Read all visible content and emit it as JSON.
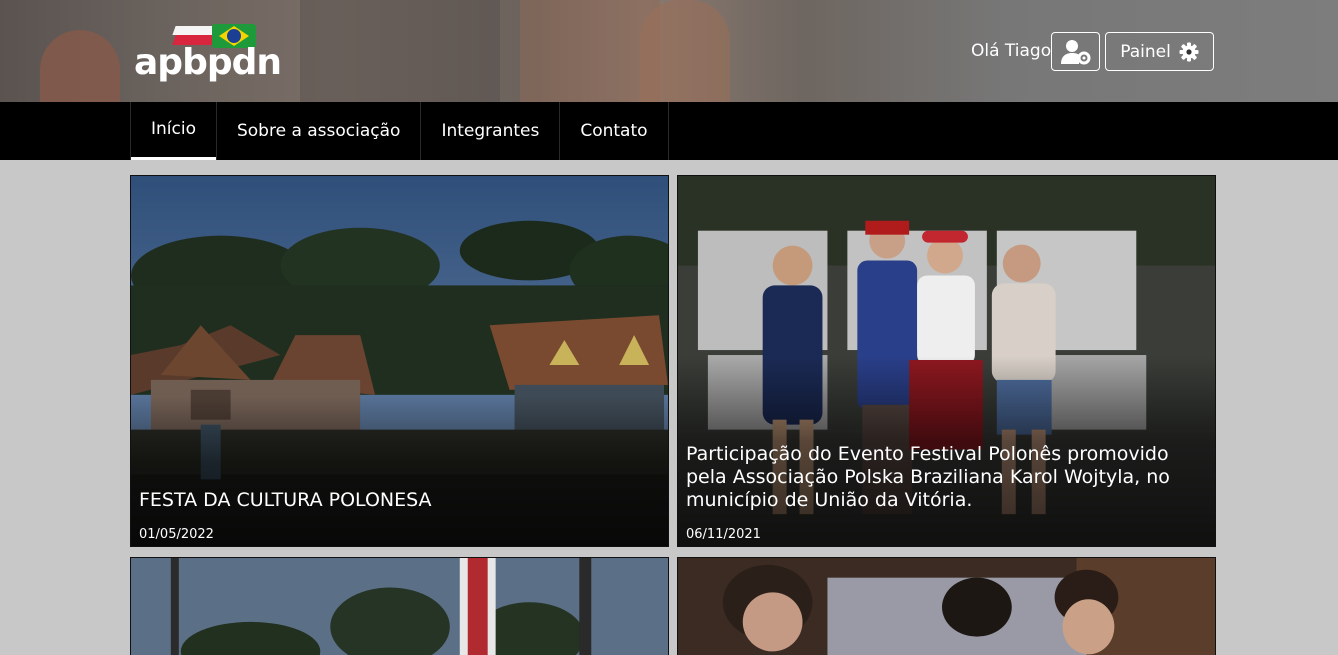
{
  "header": {
    "logo_text": "apbpdn",
    "greeting": "Olá Tiago",
    "user_button_icon": "user-cog-icon",
    "panel_label": "Painel",
    "panel_icon": "gear-icon"
  },
  "nav": {
    "items": [
      {
        "label": "Início",
        "active": true
      },
      {
        "label": "Sobre a associação",
        "active": false
      },
      {
        "label": "Integrantes",
        "active": false
      },
      {
        "label": "Contato",
        "active": false
      }
    ]
  },
  "posts": [
    {
      "title": "FESTA DA CULTURA POLONESA",
      "date": "01/05/2022"
    },
    {
      "title": "Participação do Evento Festival Polonês promovido pela Associação Polska Braziliana Karol Wojtyla, no município de União da Vitória.",
      "date": "06/11/2021"
    }
  ],
  "colors": {
    "nav_bg": "#000000",
    "page_bg": "#c8c8c8",
    "flag_red": "#d7263d",
    "flag_green": "#1e9a3a",
    "flag_yellow": "#f5d400",
    "flag_blue": "#1b3f95"
  }
}
